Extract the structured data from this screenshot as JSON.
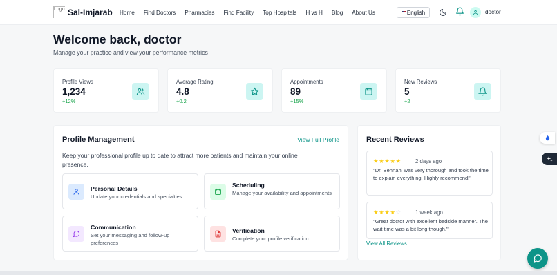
{
  "nav": {
    "logo_alt": "Logo",
    "brand": "Sal-Imjarab",
    "links": [
      "Home",
      "Find Doctors",
      "Pharmacies",
      "Find Facility",
      "Top Hospitals",
      "H vs H",
      "Blog",
      "About Us"
    ],
    "language": "English",
    "user": "doctor"
  },
  "header": {
    "title": "Welcome back, doctor",
    "subtitle": "Manage your practice and view your performance metrics"
  },
  "stats": [
    {
      "label": "Profile Views",
      "value": "1,234",
      "change": "+12%",
      "icon": "users-icon"
    },
    {
      "label": "Average Rating",
      "value": "4.8",
      "change": "+0.2",
      "icon": "star-icon"
    },
    {
      "label": "Appointments",
      "value": "89",
      "change": "+15%",
      "icon": "calendar-icon"
    },
    {
      "label": "New Reviews",
      "value": "5",
      "change": "+2",
      "icon": "bell-icon"
    }
  ],
  "profile": {
    "title": "Profile Management",
    "link": "View Full Profile",
    "description": "Keep your professional profile up to date to attract more patients and maintain your online presence.",
    "tiles": [
      {
        "title": "Personal Details",
        "desc": "Update your credentials and specialties",
        "icon": "user-icon",
        "color": "#dbeafe"
      },
      {
        "title": "Scheduling",
        "desc": "Manage your availability and appointments",
        "icon": "calendar-icon",
        "color": "#dcfce7"
      },
      {
        "title": "Communication",
        "desc": "Set your messaging and follow-up preferences",
        "icon": "message-icon",
        "color": "#f3e8ff"
      },
      {
        "title": "Verification",
        "desc": "Complete your profile verification",
        "icon": "document-icon",
        "color": "#fee2e2"
      }
    ]
  },
  "reviews": {
    "title": "Recent Reviews",
    "items": [
      {
        "rating": 5,
        "ago": "2 days ago",
        "text": "\"Dr. Bennani was very thorough and took the time to explain everything. Highly recommend!\""
      },
      {
        "rating": 4,
        "ago": "1 week ago",
        "text": "\"Great doctor with excellent bedside manner. The wait time was a bit long though.\""
      }
    ],
    "link": "View All Reviews"
  },
  "colors": {
    "accent": "#0d9488",
    "icon_bg": "#ccf5f2",
    "positive": "#16a34a",
    "star": "#facc15"
  }
}
